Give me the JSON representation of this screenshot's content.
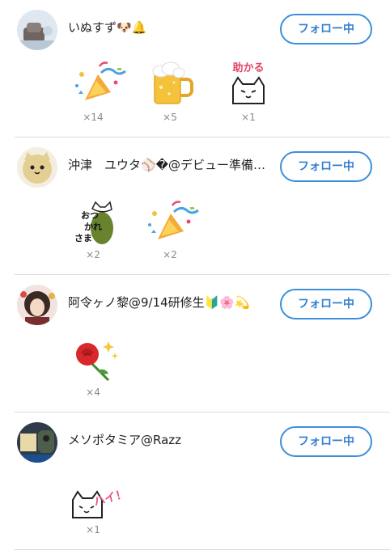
{
  "follow_label": "フォロー中",
  "rows": [
    {
      "name": "いぬすず🐶🔔",
      "stamps": [
        {
          "icon": "party-popper-icon",
          "count": "×14"
        },
        {
          "icon": "beer-mug-icon",
          "count": "×5"
        },
        {
          "icon": "cat-tasukaru-icon",
          "text": "助かる",
          "count": "×1"
        }
      ]
    },
    {
      "name": "沖津　ユウタ⚾️�@デビュー準備…",
      "stamps": [
        {
          "icon": "cat-otsukaresama-icon",
          "text": "おつかれさま",
          "count": "×2"
        },
        {
          "icon": "party-popper-icon",
          "count": "×2"
        }
      ]
    },
    {
      "name": "阿令ヶノ黎@9/14研修生🔰🌸💫",
      "stamps": [
        {
          "icon": "red-rose-icon",
          "count": "×4"
        }
      ]
    },
    {
      "name": "メソポタミア@Razz",
      "stamps": [
        {
          "icon": "cat-hai-icon",
          "text": "ハイ！",
          "count": "×1"
        }
      ]
    }
  ]
}
